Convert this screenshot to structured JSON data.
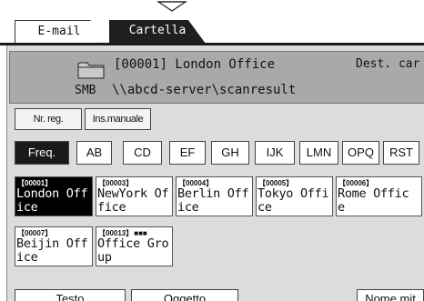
{
  "tabs": [
    {
      "label": "E-mail",
      "selected": false
    },
    {
      "label": "Cartella",
      "selected": true
    }
  ],
  "destination": {
    "number_name": "[00001] London Office",
    "type": "Dest. car",
    "protocol": "SMB",
    "path": "\\\\abcd-server\\scanresult"
  },
  "buttons": {
    "nr_reg": "Nr. reg.",
    "ins_manuale": "Ins.manuale"
  },
  "index": [
    {
      "label": "Freq.",
      "selected": true
    },
    {
      "label": "AB",
      "selected": false
    },
    {
      "label": "CD",
      "selected": false
    },
    {
      "label": "EF",
      "selected": false
    },
    {
      "label": "GH",
      "selected": false
    },
    {
      "label": "IJK",
      "selected": false
    },
    {
      "label": "LMN",
      "selected": false
    },
    {
      "label": "OPQ",
      "selected": false
    },
    {
      "label": "RST",
      "selected": false
    }
  ],
  "entries": [
    {
      "number": "【00001】",
      "line1": "London Off",
      "line2": "ice",
      "selected": true
    },
    {
      "number": "【00003】",
      "line1": "NewYork Of",
      "line2": "fice",
      "selected": false
    },
    {
      "number": "【00004】",
      "line1": "Berlin Off",
      "line2": "ice",
      "selected": false
    },
    {
      "number": "【00005】",
      "line1": "Tokyo Offi",
      "line2": "ce",
      "selected": false
    },
    {
      "number": "【00006】",
      "line1": "Rome Offic",
      "line2": "e",
      "selected": false
    },
    {
      "number": "【00007】",
      "line1": "Beijin Off",
      "line2": "ice",
      "selected": false
    },
    {
      "number": "【00013】",
      "line1": "Office Gro",
      "line2": "up",
      "selected": false,
      "group_icon": "group-icon"
    }
  ],
  "bottom": {
    "testo": "Testo",
    "oggetto": "Oggetto",
    "nome_mit": "Nome mit"
  }
}
